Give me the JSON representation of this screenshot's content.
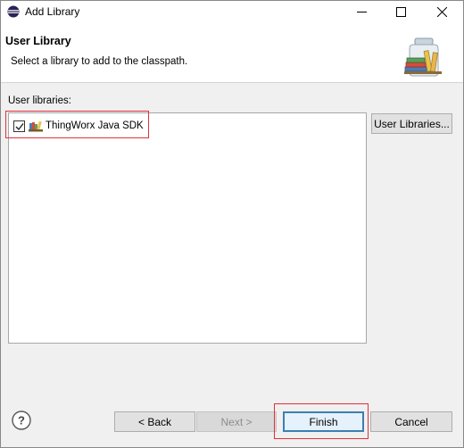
{
  "window": {
    "title": "Add Library"
  },
  "header": {
    "title": "User Library",
    "description": "Select a library to add to the classpath."
  },
  "section": {
    "label": "User libraries:"
  },
  "libraries": [
    {
      "label": "ThingWorx Java SDK",
      "checked": true
    }
  ],
  "buttons": {
    "user_libraries": "User Libraries...",
    "back": "< Back",
    "next": "Next >",
    "finish": "Finish",
    "cancel": "Cancel"
  },
  "icons": {
    "app": "eclipse-icon",
    "header": "library-jar-icon",
    "library": "library-books-icon",
    "help": "help-icon"
  },
  "colors": {
    "highlight": "#e0303a",
    "primary_border": "#3c7fb1"
  }
}
